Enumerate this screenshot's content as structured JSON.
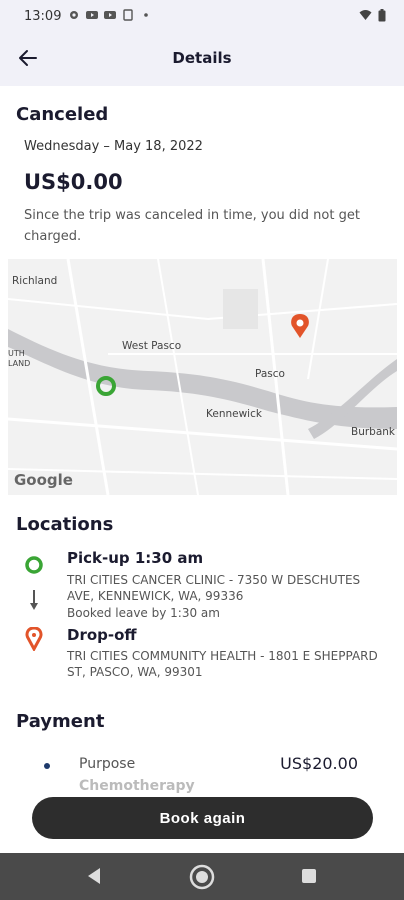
{
  "status_bar": {
    "time": "13:09"
  },
  "header": {
    "title": "Details"
  },
  "trip": {
    "status": "Canceled",
    "date": "Wednesday – May 18, 2022",
    "amount": "US$0.00",
    "note": "Since the trip was canceled in time, you did not get charged."
  },
  "map": {
    "labels": [
      "Richland",
      "West Pasco",
      "Pasco",
      "Kennewick",
      "Burbank",
      "UTH LAND"
    ],
    "attribution": "Google",
    "colors": {
      "water": "#c9c9cc",
      "roads": "#ffffff",
      "land": "#f2f2f2"
    }
  },
  "locations": {
    "heading": "Locations",
    "pickup": {
      "title": "Pick-up 1:30 am",
      "address": "TRI CITIES CANCER CLINIC - 7350 W DESCHUTES AVE, KENNEWICK, WA, 99336",
      "booked": "Booked leave by 1:30 am"
    },
    "dropoff": {
      "title": "Drop-off",
      "address": "TRI CITIES COMMUNITY HEALTH - 1801 E SHEPPARD ST, PASCO, WA, 99301"
    }
  },
  "payment": {
    "heading": "Payment",
    "purpose_label": "Purpose",
    "purpose_value": "Chemotherapy",
    "amount": "US$20.00"
  },
  "actions": {
    "book_again": "Book again"
  },
  "colors": {
    "pickup": "#3aa535",
    "dropoff": "#e2542a",
    "button": "#2d2d2d"
  }
}
